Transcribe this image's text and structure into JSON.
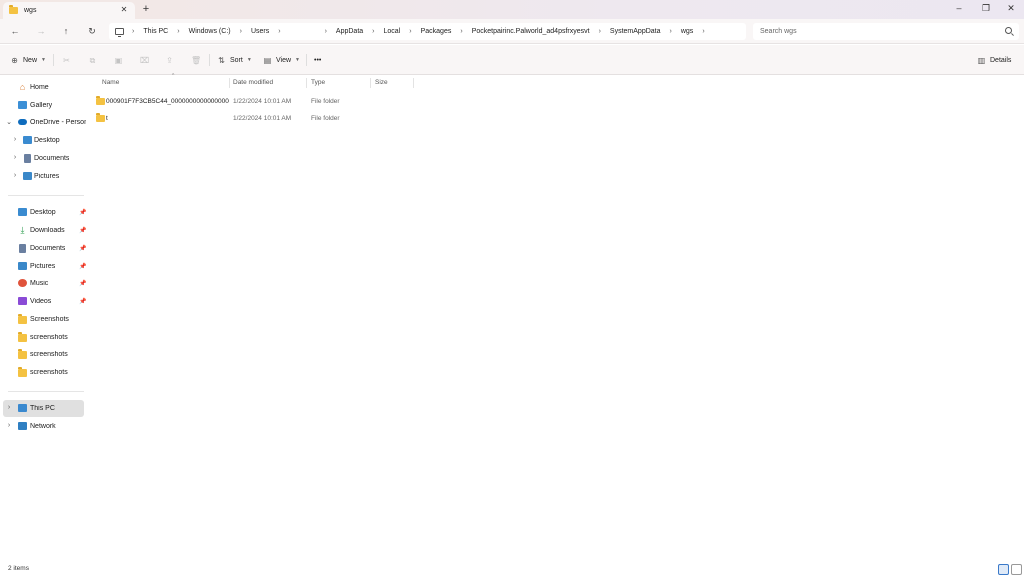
{
  "window": {
    "tab_title": "wgs",
    "tab_close": "✕",
    "new_tab": "+",
    "minimize": "–",
    "maximize": "❐",
    "close": "✕"
  },
  "nav": {
    "back": "←",
    "forward": "→",
    "up": "↑",
    "refresh": "↻",
    "breadcrumb": [
      "This PC",
      "Windows (C:)",
      "Users",
      "",
      "AppData",
      "Local",
      "Packages",
      "Pocketpairinc.Palworld_ad4psfrxyesvt",
      "SystemAppData",
      "wgs"
    ],
    "search_placeholder": "Search wgs"
  },
  "toolbar": {
    "new_label": "New",
    "sort_label": "Sort",
    "view_label": "View",
    "more_label": "•••",
    "details_label": "Details"
  },
  "sidebar": {
    "quick": [
      {
        "label": "Home",
        "icon": "home-icon"
      },
      {
        "label": "Gallery",
        "icon": "gallery-icon"
      },
      {
        "label": "OneDrive - Persona",
        "icon": "cloud-icon"
      },
      {
        "label": "Desktop",
        "icon": "desktop-icon"
      },
      {
        "label": "Documents",
        "icon": "documents-icon"
      },
      {
        "label": "Pictures",
        "icon": "pictures-icon"
      }
    ],
    "pinned": [
      {
        "label": "Desktop",
        "icon": "desktop-icon"
      },
      {
        "label": "Downloads",
        "icon": "downloads-icon"
      },
      {
        "label": "Documents",
        "icon": "documents-icon"
      },
      {
        "label": "Pictures",
        "icon": "pictures-icon"
      },
      {
        "label": "Music",
        "icon": "music-icon"
      },
      {
        "label": "Videos",
        "icon": "videos-icon"
      },
      {
        "label": "Screenshots",
        "icon": "folder-icon"
      },
      {
        "label": "screenshots",
        "icon": "folder-icon"
      },
      {
        "label": "screenshots",
        "icon": "folder-icon"
      },
      {
        "label": "screenshots",
        "icon": "folder-icon"
      }
    ],
    "devices": [
      {
        "label": "This PC",
        "icon": "pc-icon"
      },
      {
        "label": "Network",
        "icon": "network-icon"
      }
    ]
  },
  "file_list": {
    "columns": [
      "Name",
      "Date modified",
      "Type",
      "Size"
    ],
    "rows": [
      {
        "name": "000901F7F3CB5C44_000000000000000000...",
        "date": "1/22/2024 10:01 AM",
        "type": "File folder",
        "size": ""
      },
      {
        "name": "t",
        "date": "1/22/2024 10:01 AM",
        "type": "File folder",
        "size": ""
      }
    ]
  },
  "status": {
    "item_count": "2 items"
  }
}
